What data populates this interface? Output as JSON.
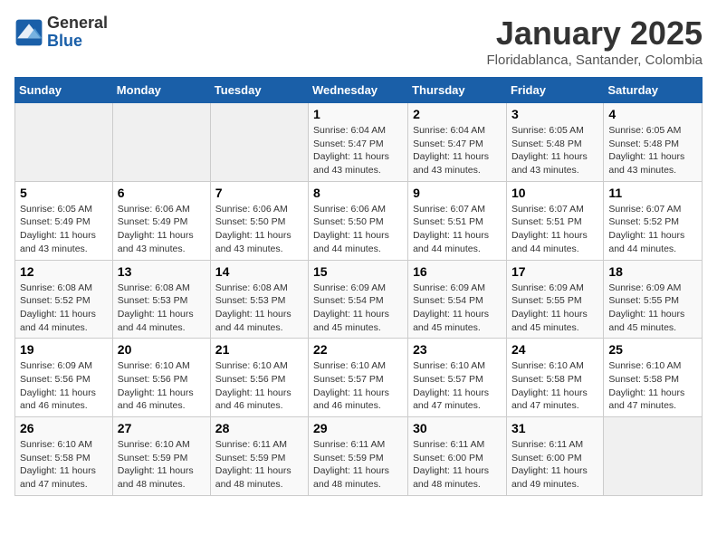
{
  "header": {
    "logo_general": "General",
    "logo_blue": "Blue",
    "title": "January 2025",
    "location": "Floridablanca, Santander, Colombia"
  },
  "weekdays": [
    "Sunday",
    "Monday",
    "Tuesday",
    "Wednesday",
    "Thursday",
    "Friday",
    "Saturday"
  ],
  "weeks": [
    [
      {
        "day": "",
        "info": ""
      },
      {
        "day": "",
        "info": ""
      },
      {
        "day": "",
        "info": ""
      },
      {
        "day": "1",
        "info": "Sunrise: 6:04 AM\nSunset: 5:47 PM\nDaylight: 11 hours\nand 43 minutes."
      },
      {
        "day": "2",
        "info": "Sunrise: 6:04 AM\nSunset: 5:47 PM\nDaylight: 11 hours\nand 43 minutes."
      },
      {
        "day": "3",
        "info": "Sunrise: 6:05 AM\nSunset: 5:48 PM\nDaylight: 11 hours\nand 43 minutes."
      },
      {
        "day": "4",
        "info": "Sunrise: 6:05 AM\nSunset: 5:48 PM\nDaylight: 11 hours\nand 43 minutes."
      }
    ],
    [
      {
        "day": "5",
        "info": "Sunrise: 6:05 AM\nSunset: 5:49 PM\nDaylight: 11 hours\nand 43 minutes."
      },
      {
        "day": "6",
        "info": "Sunrise: 6:06 AM\nSunset: 5:49 PM\nDaylight: 11 hours\nand 43 minutes."
      },
      {
        "day": "7",
        "info": "Sunrise: 6:06 AM\nSunset: 5:50 PM\nDaylight: 11 hours\nand 43 minutes."
      },
      {
        "day": "8",
        "info": "Sunrise: 6:06 AM\nSunset: 5:50 PM\nDaylight: 11 hours\nand 44 minutes."
      },
      {
        "day": "9",
        "info": "Sunrise: 6:07 AM\nSunset: 5:51 PM\nDaylight: 11 hours\nand 44 minutes."
      },
      {
        "day": "10",
        "info": "Sunrise: 6:07 AM\nSunset: 5:51 PM\nDaylight: 11 hours\nand 44 minutes."
      },
      {
        "day": "11",
        "info": "Sunrise: 6:07 AM\nSunset: 5:52 PM\nDaylight: 11 hours\nand 44 minutes."
      }
    ],
    [
      {
        "day": "12",
        "info": "Sunrise: 6:08 AM\nSunset: 5:52 PM\nDaylight: 11 hours\nand 44 minutes."
      },
      {
        "day": "13",
        "info": "Sunrise: 6:08 AM\nSunset: 5:53 PM\nDaylight: 11 hours\nand 44 minutes."
      },
      {
        "day": "14",
        "info": "Sunrise: 6:08 AM\nSunset: 5:53 PM\nDaylight: 11 hours\nand 44 minutes."
      },
      {
        "day": "15",
        "info": "Sunrise: 6:09 AM\nSunset: 5:54 PM\nDaylight: 11 hours\nand 45 minutes."
      },
      {
        "day": "16",
        "info": "Sunrise: 6:09 AM\nSunset: 5:54 PM\nDaylight: 11 hours\nand 45 minutes."
      },
      {
        "day": "17",
        "info": "Sunrise: 6:09 AM\nSunset: 5:55 PM\nDaylight: 11 hours\nand 45 minutes."
      },
      {
        "day": "18",
        "info": "Sunrise: 6:09 AM\nSunset: 5:55 PM\nDaylight: 11 hours\nand 45 minutes."
      }
    ],
    [
      {
        "day": "19",
        "info": "Sunrise: 6:09 AM\nSunset: 5:56 PM\nDaylight: 11 hours\nand 46 minutes."
      },
      {
        "day": "20",
        "info": "Sunrise: 6:10 AM\nSunset: 5:56 PM\nDaylight: 11 hours\nand 46 minutes."
      },
      {
        "day": "21",
        "info": "Sunrise: 6:10 AM\nSunset: 5:56 PM\nDaylight: 11 hours\nand 46 minutes."
      },
      {
        "day": "22",
        "info": "Sunrise: 6:10 AM\nSunset: 5:57 PM\nDaylight: 11 hours\nand 46 minutes."
      },
      {
        "day": "23",
        "info": "Sunrise: 6:10 AM\nSunset: 5:57 PM\nDaylight: 11 hours\nand 47 minutes."
      },
      {
        "day": "24",
        "info": "Sunrise: 6:10 AM\nSunset: 5:58 PM\nDaylight: 11 hours\nand 47 minutes."
      },
      {
        "day": "25",
        "info": "Sunrise: 6:10 AM\nSunset: 5:58 PM\nDaylight: 11 hours\nand 47 minutes."
      }
    ],
    [
      {
        "day": "26",
        "info": "Sunrise: 6:10 AM\nSunset: 5:58 PM\nDaylight: 11 hours\nand 47 minutes."
      },
      {
        "day": "27",
        "info": "Sunrise: 6:10 AM\nSunset: 5:59 PM\nDaylight: 11 hours\nand 48 minutes."
      },
      {
        "day": "28",
        "info": "Sunrise: 6:11 AM\nSunset: 5:59 PM\nDaylight: 11 hours\nand 48 minutes."
      },
      {
        "day": "29",
        "info": "Sunrise: 6:11 AM\nSunset: 5:59 PM\nDaylight: 11 hours\nand 48 minutes."
      },
      {
        "day": "30",
        "info": "Sunrise: 6:11 AM\nSunset: 6:00 PM\nDaylight: 11 hours\nand 48 minutes."
      },
      {
        "day": "31",
        "info": "Sunrise: 6:11 AM\nSunset: 6:00 PM\nDaylight: 11 hours\nand 49 minutes."
      },
      {
        "day": "",
        "info": ""
      }
    ]
  ]
}
